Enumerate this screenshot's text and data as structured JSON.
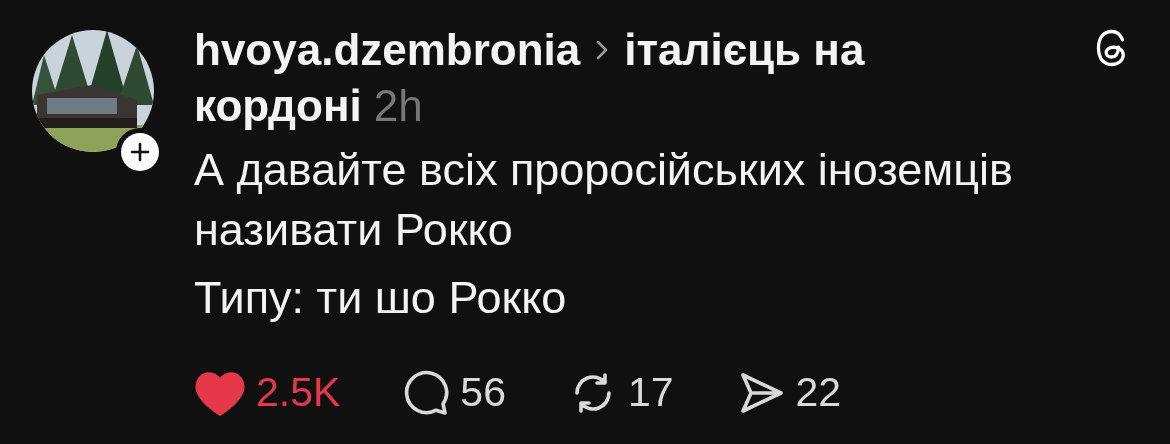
{
  "post": {
    "username": "hvoya.dzembronia",
    "community_lines": [
      "італієць на",
      "кордоні"
    ],
    "time": "2h",
    "paragraphs": [
      "А давайте всіх проросійських іноземців називати Рокко",
      "Типу: ти шо Рокко"
    ]
  },
  "actions": [
    {
      "kind": "like",
      "count": "2.5K",
      "liked": true
    },
    {
      "kind": "comment",
      "count": "56"
    },
    {
      "kind": "repost",
      "count": "17"
    },
    {
      "kind": "share",
      "count": "22"
    }
  ]
}
